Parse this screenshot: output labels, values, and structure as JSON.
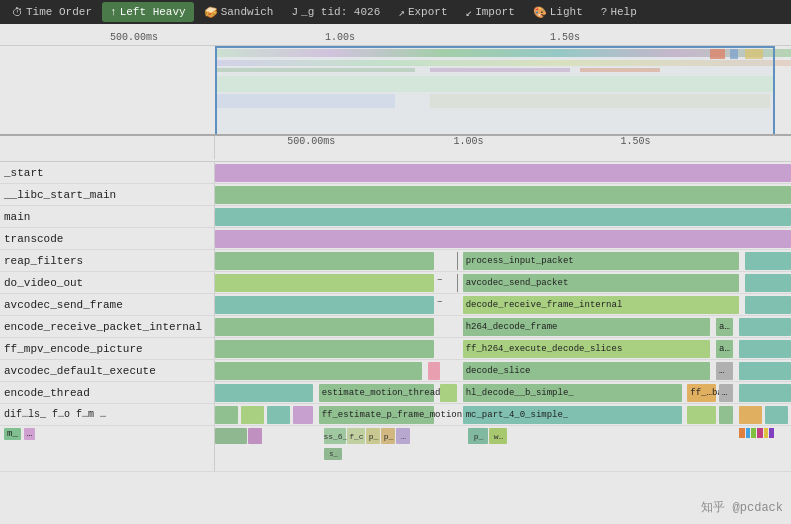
{
  "toolbar": {
    "items": [
      {
        "id": "time-order",
        "label": "Time Order",
        "icon": "⏱",
        "active": false
      },
      {
        "id": "left-heavy",
        "label": "Left Heavy",
        "icon": "↑",
        "active": true
      },
      {
        "id": "sandwich",
        "label": "Sandwich",
        "icon": "🥪",
        "active": false
      },
      {
        "id": "tid",
        "label": "_g tid: 4026",
        "icon": "",
        "active": false
      },
      {
        "id": "export",
        "label": "Export",
        "icon": "↗",
        "active": false
      },
      {
        "id": "import",
        "label": "Import",
        "icon": "↙",
        "active": false
      },
      {
        "id": "light",
        "label": "Light",
        "icon": "🎨",
        "active": false
      },
      {
        "id": "help",
        "label": "Help",
        "icon": "?",
        "active": false
      }
    ]
  },
  "timeline": {
    "markers": [
      "500.00ms",
      "1.00s",
      "1.50s"
    ],
    "markers2": [
      "500.00ms",
      "1.00s",
      "1.50s"
    ]
  },
  "flamegraph": {
    "rows": [
      {
        "label": "_start",
        "color": "purple"
      },
      {
        "label": "__libc_start_main",
        "color": "green"
      },
      {
        "label": "main",
        "color": "teal"
      },
      {
        "label": "transcode",
        "color": "purple"
      },
      {
        "label": "reap_filters",
        "color": "green",
        "right_label": "process_input_packet",
        "right_color": "green"
      },
      {
        "label": "do_video_out",
        "color": "lime",
        "right_label": "avcodec_send_packet",
        "right_color": "green"
      },
      {
        "label": "avcodec_send_frame",
        "color": "teal",
        "right_label": "decode_receive_frame_internal",
        "right_color": "lime"
      },
      {
        "label": "encode_receive_packet_internal",
        "color": "green",
        "right_label": "h264_decode_frame",
        "right_color": "green"
      },
      {
        "label": "ff_mpv_encode_picture",
        "color": "green",
        "right_label": "ff_h264_execute_decode_slices",
        "right_color": "lime"
      },
      {
        "label": "avcodec_default_execute",
        "color": "green",
        "right_label": "decode_slice",
        "right_color": "green"
      },
      {
        "label": "encode_thread",
        "color": "teal",
        "mid_label": "estimate_motion_thread",
        "mid_color": "green",
        "right_label": "hl_decode_mb_simple_",
        "right_color": "green"
      },
      {
        "label": "dif_ls_ f_o f_m ...",
        "color": "multi",
        "mid_label": "ff_estimate_p_frame_motion",
        "mid_color": "green",
        "right_label": "mc_part_4x0_simple_",
        "right_color": "teal"
      },
      {
        "label": "m_ ...",
        "color": "multi2",
        "mid_label": "ss_6_ f_c p_ p_ ...",
        "mid_color": "multi3",
        "right_label": "p_ w_",
        "right_color": "multi4"
      }
    ]
  },
  "watermark": "知乎 @pcdack"
}
